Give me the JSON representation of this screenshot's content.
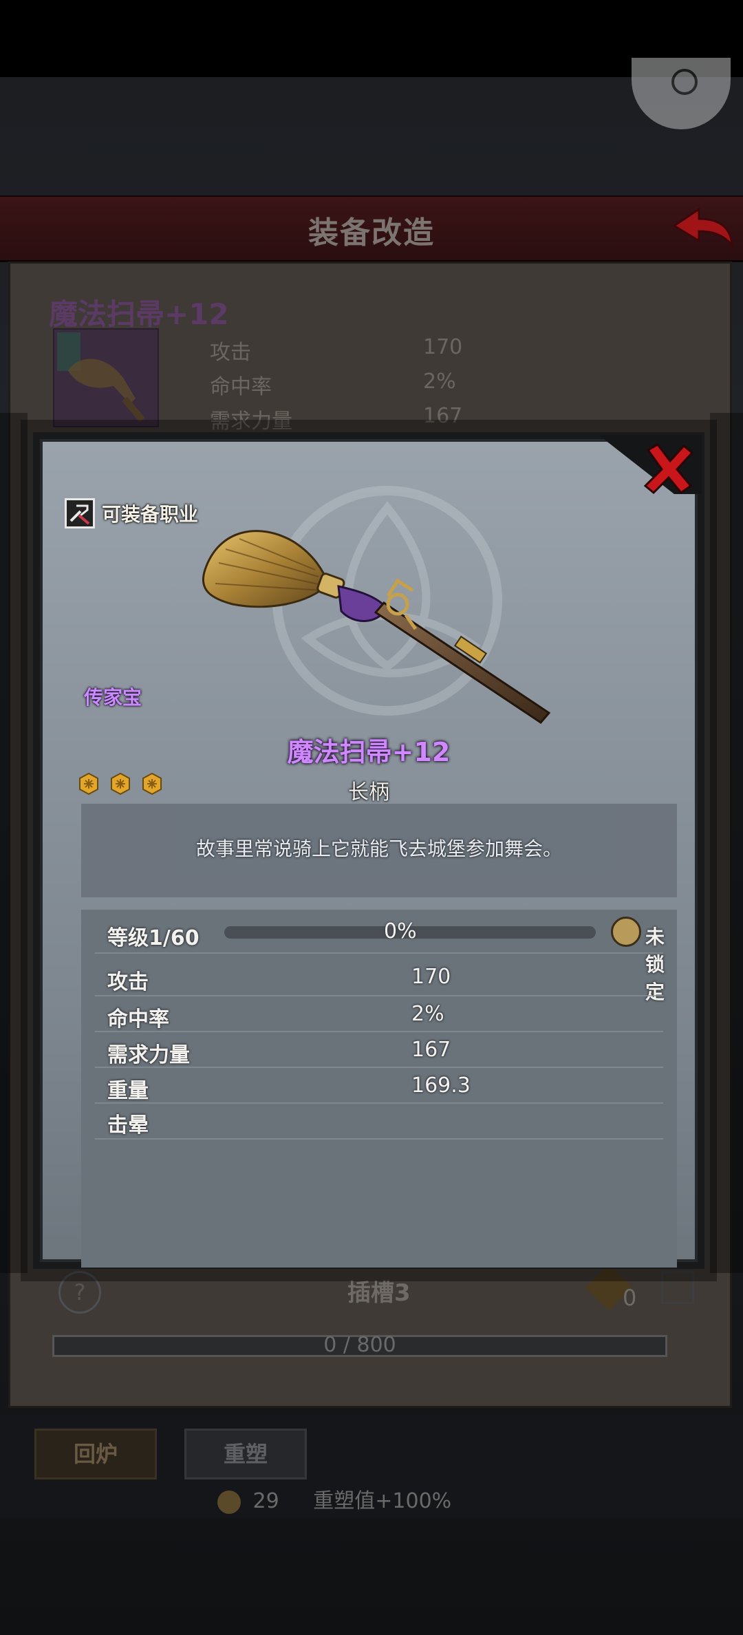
{
  "screen": {
    "title": "装备改造"
  },
  "background_item": {
    "name": "魔法扫帚+12",
    "stats": [
      {
        "label": "攻击",
        "value": "170"
      },
      {
        "label": "命中率",
        "value": "2%"
      },
      {
        "label": "需求力量",
        "value": "167"
      }
    ],
    "slot_label": "插槽3",
    "slot_count": "0",
    "progress_text": "0 / 800",
    "buttons": {
      "return": "回炉",
      "remold": "重塑"
    },
    "cost_amount": "29",
    "remold_bonus": "重塑值+100%"
  },
  "item_detail": {
    "class_label": "可装备职业",
    "rarity": "传家宝",
    "name": "魔法扫帚+12",
    "type": "长柄",
    "stars": 3,
    "description": "故事里常说骑上它就能飞去城堡参加舞会。",
    "level_label": "等级1/60",
    "level_percent": "0%",
    "level_progress": 0,
    "lock_label": "未锁定",
    "stats": [
      {
        "label": "攻击",
        "value": "170"
      },
      {
        "label": "命中率",
        "value": "2%"
      },
      {
        "label": "需求力量",
        "value": "167"
      },
      {
        "label": "重量",
        "value": "169.3"
      },
      {
        "label": "击晕",
        "value": ""
      }
    ]
  },
  "colors": {
    "header": "#3b1416",
    "rarity_purple": "#cf88ff",
    "close_red": "#c8161b",
    "star_gold": "#e2a72a"
  },
  "icons": {
    "close": "close-icon",
    "class": "class-tool-icon",
    "lock": "lock-icon",
    "star": "star-icon",
    "back": "back-arrow-icon",
    "help": "help-icon"
  }
}
